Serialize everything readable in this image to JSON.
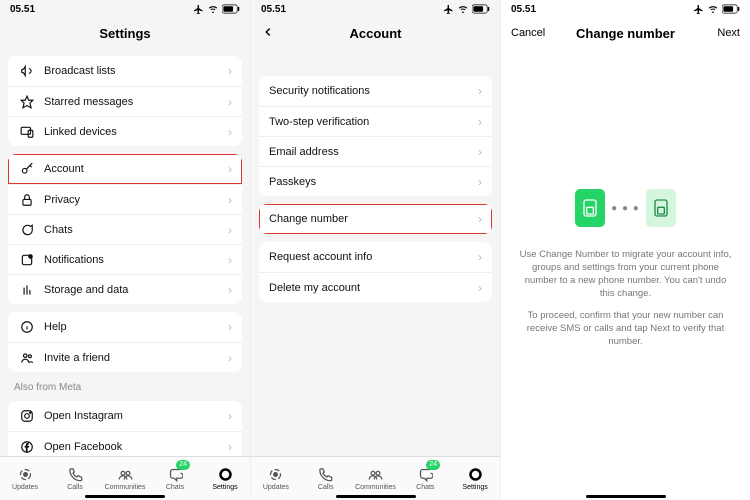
{
  "status": {
    "time": "05.51"
  },
  "tabs": {
    "updates": "Updates",
    "calls": "Calls",
    "communities": "Communities",
    "chats": "Chats",
    "settings": "Settings",
    "badge": "24"
  },
  "screen1": {
    "title": "Settings",
    "group1": [
      {
        "label": "Broadcast lists"
      },
      {
        "label": "Starred messages"
      },
      {
        "label": "Linked devices"
      }
    ],
    "group2": [
      {
        "label": "Account",
        "highlight": true
      },
      {
        "label": "Privacy"
      },
      {
        "label": "Chats"
      },
      {
        "label": "Notifications"
      },
      {
        "label": "Storage and data"
      }
    ],
    "group3": [
      {
        "label": "Help"
      },
      {
        "label": "Invite a friend"
      }
    ],
    "metaHeader": "Also from Meta",
    "group4": [
      {
        "label": "Open Instagram"
      },
      {
        "label": "Open Facebook"
      }
    ]
  },
  "screen2": {
    "title": "Account",
    "group1": [
      {
        "label": "Security notifications"
      },
      {
        "label": "Two-step verification"
      },
      {
        "label": "Email address"
      },
      {
        "label": "Passkeys"
      }
    ],
    "group2": [
      {
        "label": "Change number",
        "highlight": true
      }
    ],
    "group3": [
      {
        "label": "Request account info"
      },
      {
        "label": "Delete my account"
      }
    ]
  },
  "screen3": {
    "title": "Change number",
    "cancel": "Cancel",
    "next": "Next",
    "para1": "Use Change Number to migrate your account info, groups and settings from your current phone number to a new phone number. You can't undo this change.",
    "para2": "To proceed, confirm that your new number can receive SMS or calls and tap Next to verify that number."
  }
}
